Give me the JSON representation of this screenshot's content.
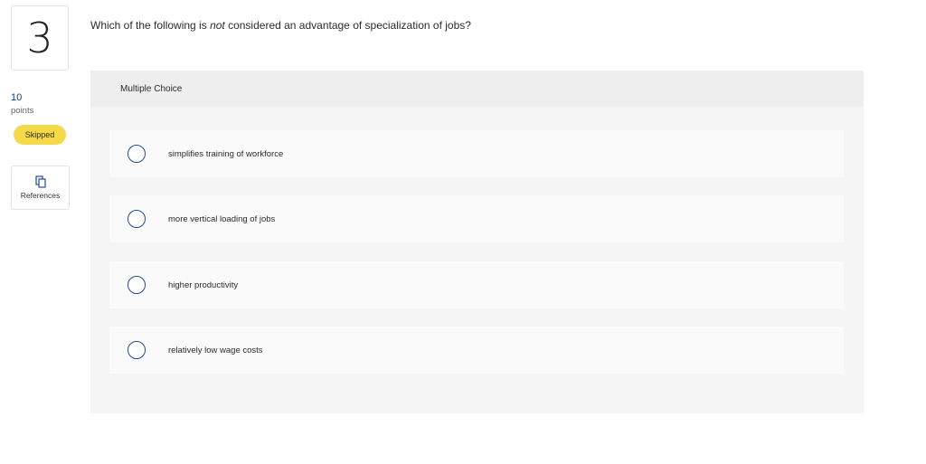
{
  "question": {
    "number": "3",
    "text_before": "Which of the following is ",
    "text_emphasis": "not",
    "text_after": " considered an advantage of specialization of jobs?"
  },
  "sidebar": {
    "points_value": "10",
    "points_label": "points",
    "status_badge": "Skipped",
    "references_label": "References",
    "references_icon": "copy-icon"
  },
  "choices": {
    "header": "Multiple Choice",
    "options": [
      {
        "label": "simplifies training of workforce"
      },
      {
        "label": "more vertical loading of jobs"
      },
      {
        "label": "higher productivity"
      },
      {
        "label": "relatively low wage costs"
      }
    ]
  },
  "colors": {
    "badge": "#f6d94a",
    "radio_border": "#1f4f8f",
    "points_value": "#0b3c7a",
    "panel_bg": "#f5f5f5",
    "header_bg": "#eeeeee"
  }
}
